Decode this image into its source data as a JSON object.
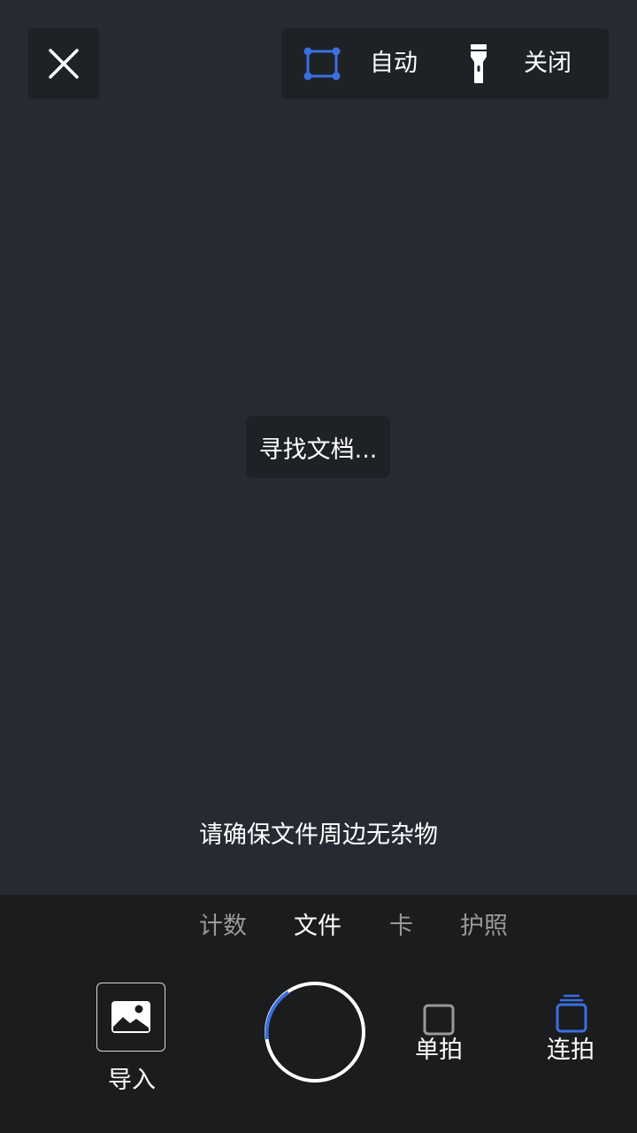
{
  "header": {
    "close_icon": "close-icon",
    "crop_mode_label": "自动",
    "flash_label": "关闭"
  },
  "viewfinder": {
    "status_text": "寻找文档...",
    "hint_text": "请确保文件周边无杂物"
  },
  "modes": {
    "tabs": [
      {
        "label": "计数",
        "active": false
      },
      {
        "label": "文件",
        "active": true
      },
      {
        "label": "卡",
        "active": false
      },
      {
        "label": "护照",
        "active": false
      }
    ]
  },
  "controls": {
    "import_label": "导入",
    "single_shot_label": "单拍",
    "burst_label": "连拍",
    "burst_selected": true
  },
  "colors": {
    "accent": "#3a6fe0",
    "background": "#262b33",
    "panel": "#1b1c1e"
  }
}
